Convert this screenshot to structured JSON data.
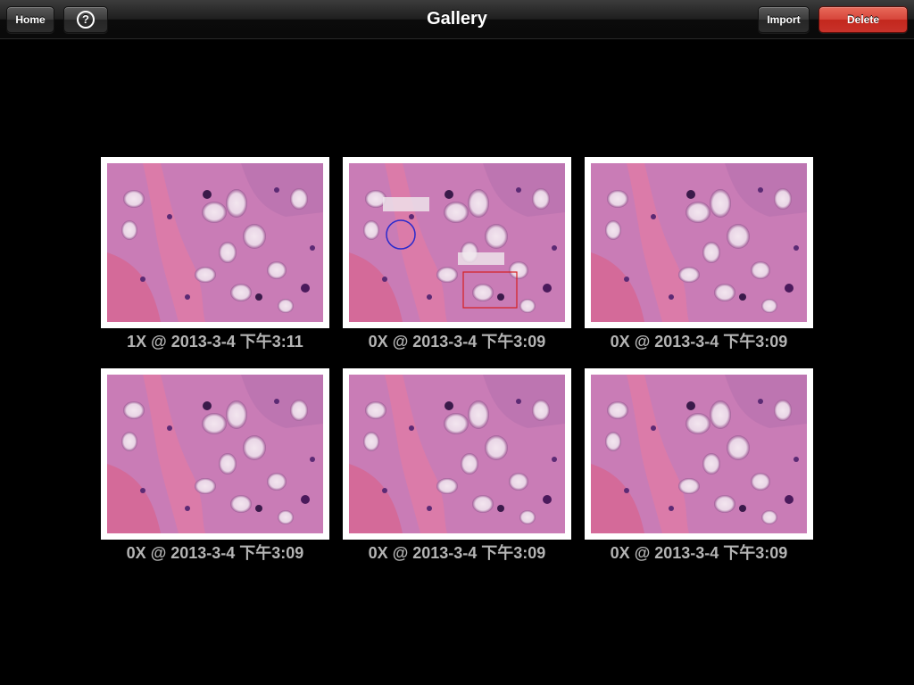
{
  "header": {
    "title": "Gallery",
    "home_label": "Home",
    "help_label": "?",
    "import_label": "Import",
    "delete_label": "Delete"
  },
  "colors": {
    "nav_background": "#1a1a1a",
    "delete_button": "#d13a2f",
    "caption_text": "#b4b4b4",
    "page_background": "#000000",
    "annotation_circle": "#2a2acc",
    "annotation_rect": "#d62020"
  },
  "gallery": {
    "items": [
      {
        "caption": "1X @ 2013-3-4 下午3:11",
        "annotated": false
      },
      {
        "caption": "0X @ 2013-3-4 下午3:09",
        "annotated": true
      },
      {
        "caption": "0X @ 2013-3-4 下午3:09",
        "annotated": false
      },
      {
        "caption": "0X @ 2013-3-4 下午3:09",
        "annotated": false
      },
      {
        "caption": "0X @ 2013-3-4 下午3:09",
        "annotated": false
      },
      {
        "caption": "0X @ 2013-3-4 下午3:09",
        "annotated": false
      }
    ]
  }
}
